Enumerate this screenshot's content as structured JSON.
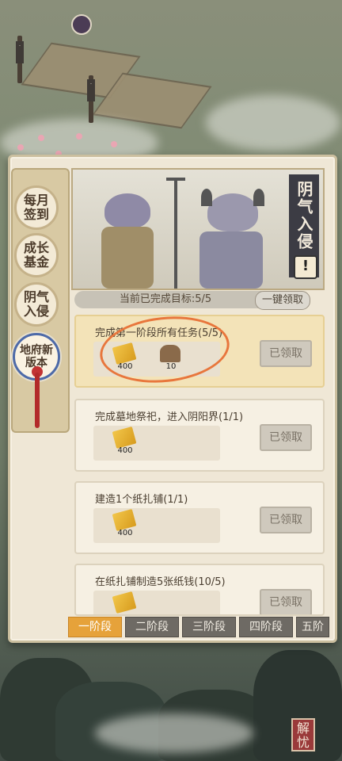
{
  "side_tabs": [
    {
      "label": "每月签到",
      "active": false
    },
    {
      "label": "成长基金",
      "active": false
    },
    {
      "label": "阴气入侵",
      "active": false
    },
    {
      "label": "地府新版本",
      "active": true
    }
  ],
  "event": {
    "title": "阴气入侵",
    "warn_icon": "exclamation-icon"
  },
  "progress": {
    "text": "当前已完成目标:5/5",
    "completed": 5,
    "total": 5,
    "claim_all_label": "一键领取"
  },
  "tasks": [
    {
      "title": "完成第一阶段所有任务(5/5)",
      "status": "已领取",
      "highlight": true,
      "rewards": [
        {
          "icon": "paper-money-icon",
          "qty": "400"
        },
        {
          "icon": "bell-icon",
          "qty": "10"
        }
      ]
    },
    {
      "title": "完成墓地祭祀，进入阴阳界(1/1)",
      "status": "已领取",
      "highlight": false,
      "rewards": [
        {
          "icon": "paper-money-icon",
          "qty": "400"
        }
      ]
    },
    {
      "title": "建造1个纸扎铺(1/1)",
      "status": "已领取",
      "highlight": false,
      "rewards": [
        {
          "icon": "paper-money-icon",
          "qty": "400"
        }
      ]
    },
    {
      "title": "在纸扎铺制造5张纸钱(10/5)",
      "status": "已领取",
      "highlight": false,
      "rewards": [
        {
          "icon": "paper-money-icon",
          "qty": ""
        }
      ]
    }
  ],
  "stage_tabs": [
    {
      "label": "一阶段",
      "active": true
    },
    {
      "label": "二阶段",
      "active": false
    },
    {
      "label": "三阶段",
      "active": false
    },
    {
      "label": "四阶段",
      "active": false
    },
    {
      "label": "五阶",
      "active": false
    }
  ],
  "seal_text": "解忧",
  "colors": {
    "accent": "#e6a23a",
    "ring": "#e8763c",
    "title_bg": "#3c3c44"
  }
}
